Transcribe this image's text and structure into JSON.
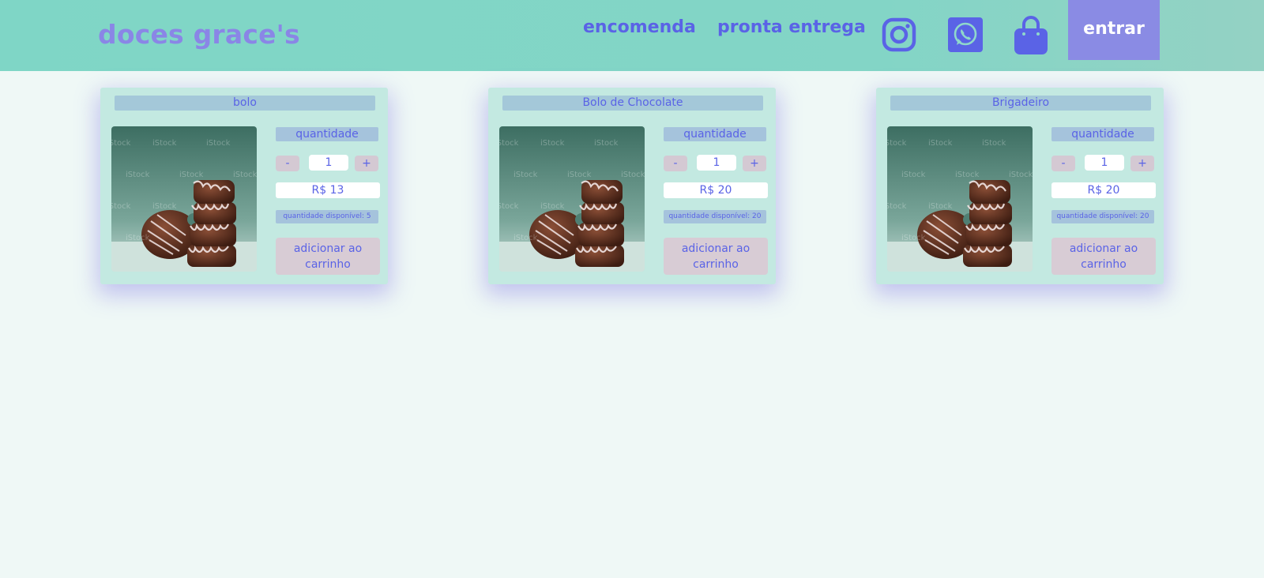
{
  "header": {
    "brand": "doces grace's",
    "nav": {
      "encomenda": "encomenda",
      "pronta_entrega": "pronta entrega"
    },
    "icons": {
      "instagram": "instagram-icon",
      "whatsapp": "whatsapp-icon",
      "bag": "shopping-bag-icon"
    },
    "login_label": "entrar"
  },
  "colors": {
    "header_bg": "#7fd6c6",
    "page_bg": "#eff8f6",
    "accent_text": "#5a63e6",
    "brand_text": "#8a86e6",
    "login_bg": "#8a8be4",
    "card_bg": "#c3e9e1"
  },
  "product_image": {
    "watermark": "iStock"
  },
  "products": [
    {
      "name": "bolo",
      "quantity_label": "quantidade",
      "minus": "-",
      "quantity": "1",
      "plus": "+",
      "price": "R$ 13",
      "available": "quantidade disponível: 5",
      "add_label": "adicionar ao carrinho"
    },
    {
      "name": "Bolo de Chocolate",
      "quantity_label": "quantidade",
      "minus": "-",
      "quantity": "1",
      "plus": "+",
      "price": "R$ 20",
      "available": "quantidade disponível: 20",
      "add_label": "adicionar ao carrinho"
    },
    {
      "name": "Brigadeiro",
      "quantity_label": "quantidade",
      "minus": "-",
      "quantity": "1",
      "plus": "+",
      "price": "R$ 20",
      "available": "quantidade disponível: 20",
      "add_label": "adicionar ao carrinho"
    }
  ]
}
